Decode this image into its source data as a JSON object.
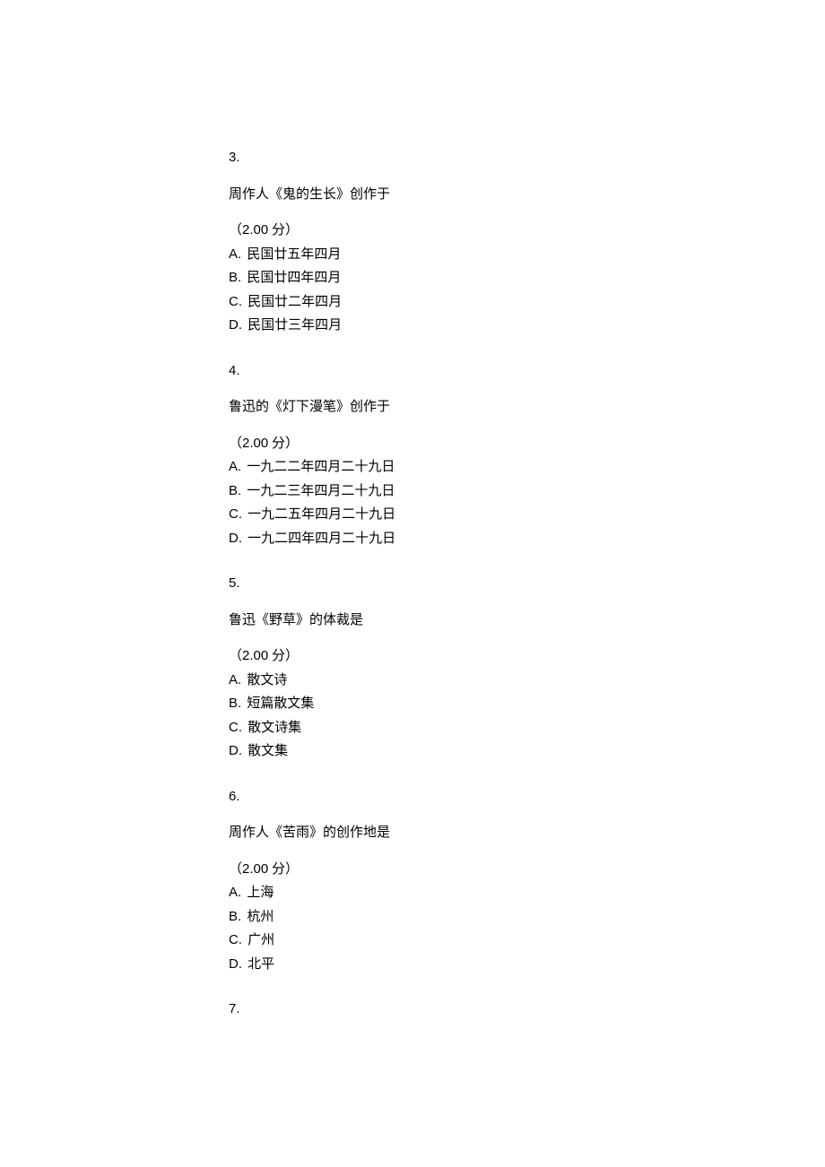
{
  "points_prefix": "（",
  "points_value": "2.00",
  "points_suffix": " 分）",
  "questions": [
    {
      "number": "3.",
      "stem": "周作人《鬼的生长》创作于",
      "options": [
        {
          "letter": "A.",
          "text": "民国廿五年四月"
        },
        {
          "letter": "B.",
          "text": "民国廿四年四月"
        },
        {
          "letter": "C.",
          "text": "民国廿二年四月"
        },
        {
          "letter": "D.",
          "text": "民国廿三年四月"
        }
      ]
    },
    {
      "number": "4.",
      "stem": "鲁迅的《灯下漫笔》创作于",
      "options": [
        {
          "letter": "A.",
          "text": "一九二二年四月二十九日"
        },
        {
          "letter": "B.",
          "text": "一九二三年四月二十九日"
        },
        {
          "letter": "C.",
          "text": "一九二五年四月二十九日"
        },
        {
          "letter": "D.",
          "text": "一九二四年四月二十九日"
        }
      ]
    },
    {
      "number": "5.",
      "stem": "鲁迅《野草》的体裁是",
      "options": [
        {
          "letter": "A.",
          "text": "散文诗"
        },
        {
          "letter": "B.",
          "text": "短篇散文集"
        },
        {
          "letter": "C.",
          "text": "散文诗集"
        },
        {
          "letter": "D.",
          "text": "散文集"
        }
      ]
    },
    {
      "number": "6.",
      "stem": "周作人《苦雨》的创作地是",
      "options": [
        {
          "letter": "A.",
          "text": "上海"
        },
        {
          "letter": "B.",
          "text": "杭州"
        },
        {
          "letter": "C.",
          "text": "广州"
        },
        {
          "letter": "D.",
          "text": "北平"
        }
      ]
    },
    {
      "number": "7.",
      "stem": "",
      "options": []
    }
  ]
}
